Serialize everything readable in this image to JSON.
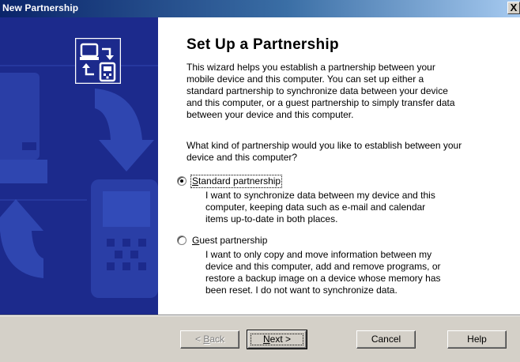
{
  "window": {
    "title": "New Partnership",
    "close_symbol": "X"
  },
  "banner": {
    "icon": "sync-devices-icon"
  },
  "main": {
    "heading": "Set Up a Partnership",
    "intro_lines": [
      "This wizard helps you establish a partnership between your",
      "mobile device and this computer.  You can set up either a",
      "standard partnership to synchronize data between your device",
      "and this computer, or a guest partnership to simply transfer data",
      "between your device and this computer."
    ],
    "question_lines": [
      "What kind of partnership would you like to establish between your",
      "device and this computer?"
    ],
    "options": [
      {
        "label_mnemonic": "S",
        "label_rest": "tandard partnership",
        "selected": true,
        "desc_lines": [
          "I want to synchronize data between my device and this",
          "computer, keeping data such as e-mail and calendar",
          "items up-to-date in both places."
        ]
      },
      {
        "label_mnemonic": "G",
        "label_rest": "uest partnership",
        "selected": false,
        "desc_lines": [
          "I want to only copy and move information between my",
          "device and this computer, add and remove programs, or",
          "restore a backup image on a device whose memory has",
          "been reset. I do not want to synchronize data."
        ]
      }
    ]
  },
  "footer": {
    "back": {
      "prefix": "< ",
      "mnemonic": "B",
      "rest": "ack"
    },
    "next": {
      "mnemonic": "N",
      "rest": "ext >"
    },
    "cancel": "Cancel",
    "help": "Help"
  }
}
